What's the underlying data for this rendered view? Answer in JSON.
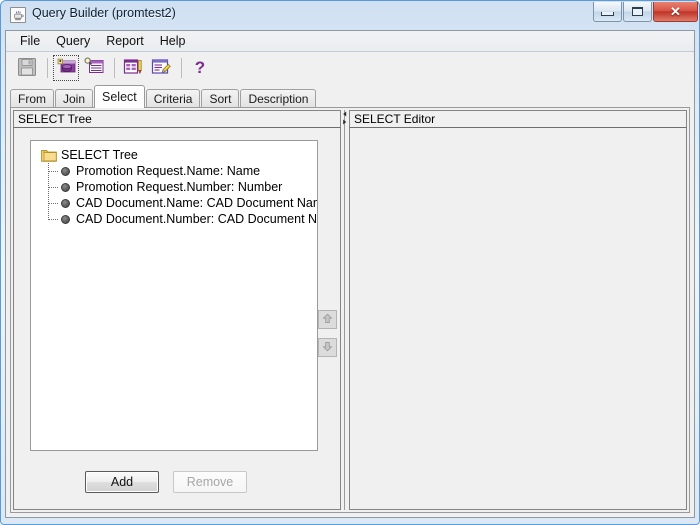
{
  "window": {
    "title": "Query Builder (promtest2)",
    "app_icon": "java-coffee-cup-icon",
    "controls": {
      "minimize": "minimize-button",
      "maximize": "maximize-button",
      "close": "close-button",
      "close_glyph": "✕"
    }
  },
  "menubar": {
    "items": [
      {
        "label": "File"
      },
      {
        "label": "Query"
      },
      {
        "label": "Report"
      },
      {
        "label": "Help"
      }
    ]
  },
  "toolbar": {
    "buttons": [
      {
        "name": "save-icon",
        "state": "disabled"
      },
      {
        "name": "execute-query-icon",
        "state": "focused"
      },
      {
        "name": "preview-query-icon",
        "state": "enabled"
      },
      {
        "name": "edit-report-icon",
        "state": "enabled"
      },
      {
        "name": "edit-description-icon",
        "state": "enabled"
      },
      {
        "name": "help-icon",
        "state": "enabled"
      }
    ]
  },
  "tabs": [
    {
      "label": "From",
      "active": false
    },
    {
      "label": "Join",
      "active": false
    },
    {
      "label": "Select",
      "active": true
    },
    {
      "label": "Criteria",
      "active": false
    },
    {
      "label": "Sort",
      "active": false
    },
    {
      "label": "Description",
      "active": false
    }
  ],
  "left_pane": {
    "header": "SELECT Tree",
    "tree": {
      "root_label": "SELECT Tree",
      "root_icon": "folder-icon",
      "nodes": [
        {
          "label": "Promotion Request.Name: Name"
        },
        {
          "label": "Promotion Request.Number: Number"
        },
        {
          "label": "CAD Document.Name: CAD Document Name"
        },
        {
          "label": "CAD Document.Number: CAD Document Number"
        }
      ]
    },
    "buttons": [
      {
        "label": "Add",
        "state": "enabled"
      },
      {
        "label": "Remove",
        "state": "disabled"
      }
    ]
  },
  "move_buttons": [
    {
      "name": "move-up-button",
      "icon": "arrow-up-icon",
      "state": "disabled"
    },
    {
      "name": "move-down-button",
      "icon": "arrow-down-icon",
      "state": "disabled"
    }
  ],
  "right_pane": {
    "header": "SELECT Editor",
    "content": ""
  },
  "colors": {
    "window_border": "#5b9bd5",
    "panel_bg": "#f0f0f0",
    "tree_bg": "#ffffff",
    "accent_purple": "#7b2d8e",
    "folder_yellow": "#e8c15a",
    "close_red": "#bf3427"
  }
}
